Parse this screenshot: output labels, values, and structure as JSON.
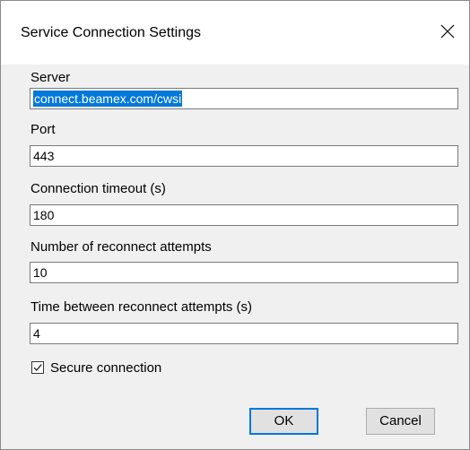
{
  "window": {
    "title": "Service Connection Settings",
    "close_icon": "close-icon"
  },
  "fields": {
    "server": {
      "label": "Server",
      "value": "connect.beamex.com/cwsi"
    },
    "port": {
      "label": "Port",
      "value": "443"
    },
    "timeout": {
      "label": "Connection timeout (s)",
      "value": "180"
    },
    "reconnect_attempts": {
      "label": "Number of reconnect attempts",
      "value": "10"
    },
    "reconnect_interval": {
      "label": "Time between reconnect attempts (s)",
      "value": "4"
    }
  },
  "secure": {
    "label": "Secure connection",
    "checked": true,
    "icon": "checkmark-icon"
  },
  "buttons": {
    "ok": "OK",
    "cancel": "Cancel"
  },
  "colors": {
    "selection": "#0078d7",
    "default_button_border": "#0078d7",
    "dialog_bg": "#f0f0f0"
  }
}
